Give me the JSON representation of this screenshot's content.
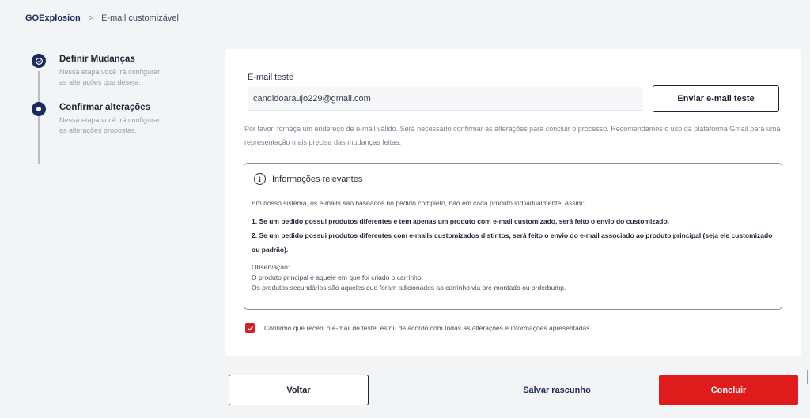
{
  "breadcrumb": {
    "home": "GOExplosion",
    "separator": ">",
    "current": "E-mail customizável"
  },
  "stepper": {
    "steps": [
      {
        "title": "Definir Mudanças",
        "description": "Nessa etapa você irá configurar as alterações que deseja.",
        "state": "completed",
        "icon": "check-icon"
      },
      {
        "title": "Confirmar alterações",
        "description": "Nessa etapa você irá configurar as alterações propostas.",
        "state": "current",
        "icon": "dot-icon"
      }
    ]
  },
  "form": {
    "email_label": "E-mail teste",
    "email_value": "candidoaraujo229@gmail.com",
    "send_test_label": "Enviar e-mail teste",
    "hint": "Por favor, forneça um endereço de e-mail válido. Será necessário confirmar as alterações para concluir o processo. Recomendamos o uso da plataforma Gmail para uma representação mais precisa das mudanças feitas."
  },
  "info": {
    "icon": "info-icon",
    "icon_glyph": "i",
    "title": "Informações relevantes",
    "intro": "Em nosso sistema, os e-mails são baseados no pedido completo, não em cada produto individualmente. Assim:",
    "rule1": "1. Se um pedido possui produtos diferentes e tem apenas um produto com e-mail customizado, será feito o envio do customizado.",
    "rule2": "2. Se um pedido possui produtos diferentes com e-mails customizados distintos, será feito o envio do e-mail associado ao produto principal (seja ele customizado ou padrão).",
    "obs_title": "Observação:",
    "obs_line1": "O produto principal é aquele em que foi criado o carrinho.",
    "obs_line2": "Os produtos secundários são aqueles que foram adicionados ao carrinho via pré-montado ou orderbump."
  },
  "confirm": {
    "checked": true,
    "label": "Confirmo que recebi o e-mail de teste, estou de acordo com todas as alterações e informações apresentadas."
  },
  "footer": {
    "back_label": "Voltar",
    "draft_label": "Salvar rascunho",
    "finish_label": "Concluir"
  },
  "colors": {
    "primary": "#1b2a5c",
    "accent_red": "#e01b1b",
    "background": "#f3f4f6"
  }
}
